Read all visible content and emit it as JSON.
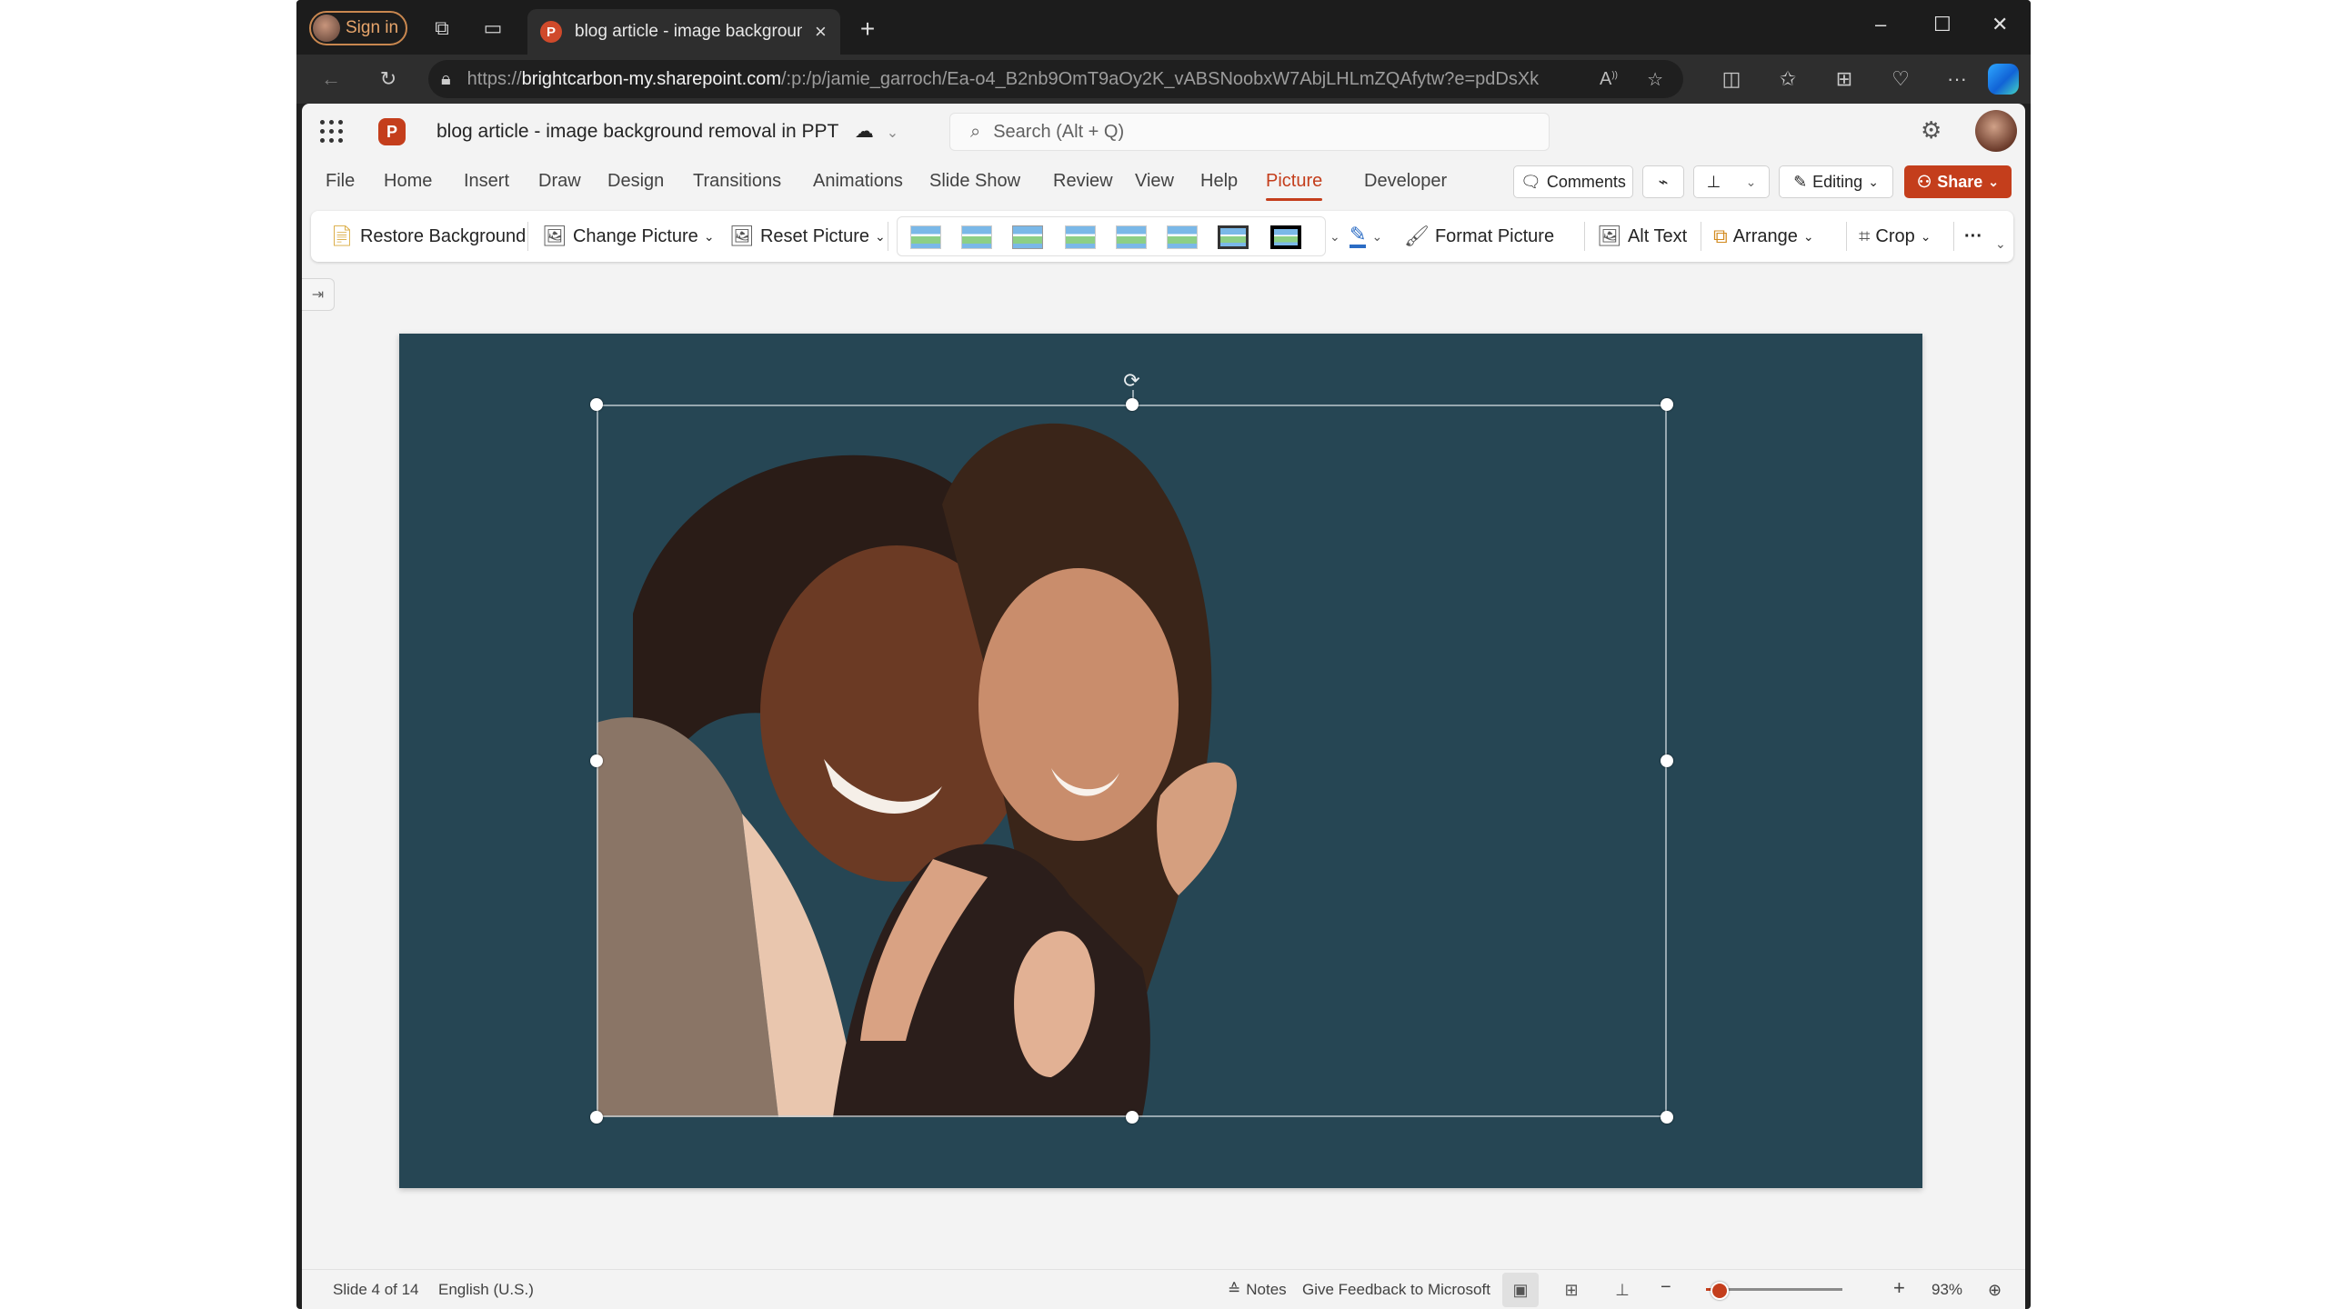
{
  "browser": {
    "sign_in_label": "Sign in",
    "tab_title": "blog article - image background removal in PPT",
    "tab_close": "×",
    "new_tab": "+",
    "window_controls": {
      "minimize": "–",
      "maximize": "☐",
      "close": "✕"
    },
    "url_scheme": "https://",
    "url_host": "brightcarbon-my.sharepoint.com",
    "url_path": "/:p:/p/jamie_garroch/Ea-o4_B2nb9OmT9aOy2K_vABSNoobxW7AbjLHLmZQAfytw?e=pdDsXk"
  },
  "app": {
    "logo_letter": "P",
    "doc_title": "blog article - image background removal in PPT",
    "search_placeholder": "Search (Alt + Q)",
    "ribbon_tabs": [
      {
        "label": "File"
      },
      {
        "label": "Home"
      },
      {
        "label": "Insert"
      },
      {
        "label": "Draw"
      },
      {
        "label": "Design"
      },
      {
        "label": "Transitions"
      },
      {
        "label": "Animations"
      },
      {
        "label": "Slide Show"
      },
      {
        "label": "Review"
      },
      {
        "label": "View"
      },
      {
        "label": "Help"
      },
      {
        "label": "Picture",
        "active": true
      },
      {
        "label": "Developer"
      }
    ],
    "comments_label": "Comments",
    "editing_label": "Editing",
    "share_label": "Share",
    "accent": "#c43e1c"
  },
  "toolbar": {
    "restore_background": "Restore Background",
    "change_picture": "Change Picture",
    "reset_picture": "Reset Picture",
    "picture_styles_count": 8,
    "format_picture": "Format Picture",
    "alt_text": "Alt Text",
    "arrange": "Arrange",
    "crop": "Crop",
    "more": "···"
  },
  "slide": {
    "background_color": "#264654",
    "selected_object": "picture"
  },
  "status": {
    "slide_info": "Slide 4 of 14",
    "language": "English (U.S.)",
    "notes": "Notes",
    "feedback": "Give Feedback to Microsoft",
    "zoom_level": "93%",
    "zoom_fraction": 0.1
  }
}
